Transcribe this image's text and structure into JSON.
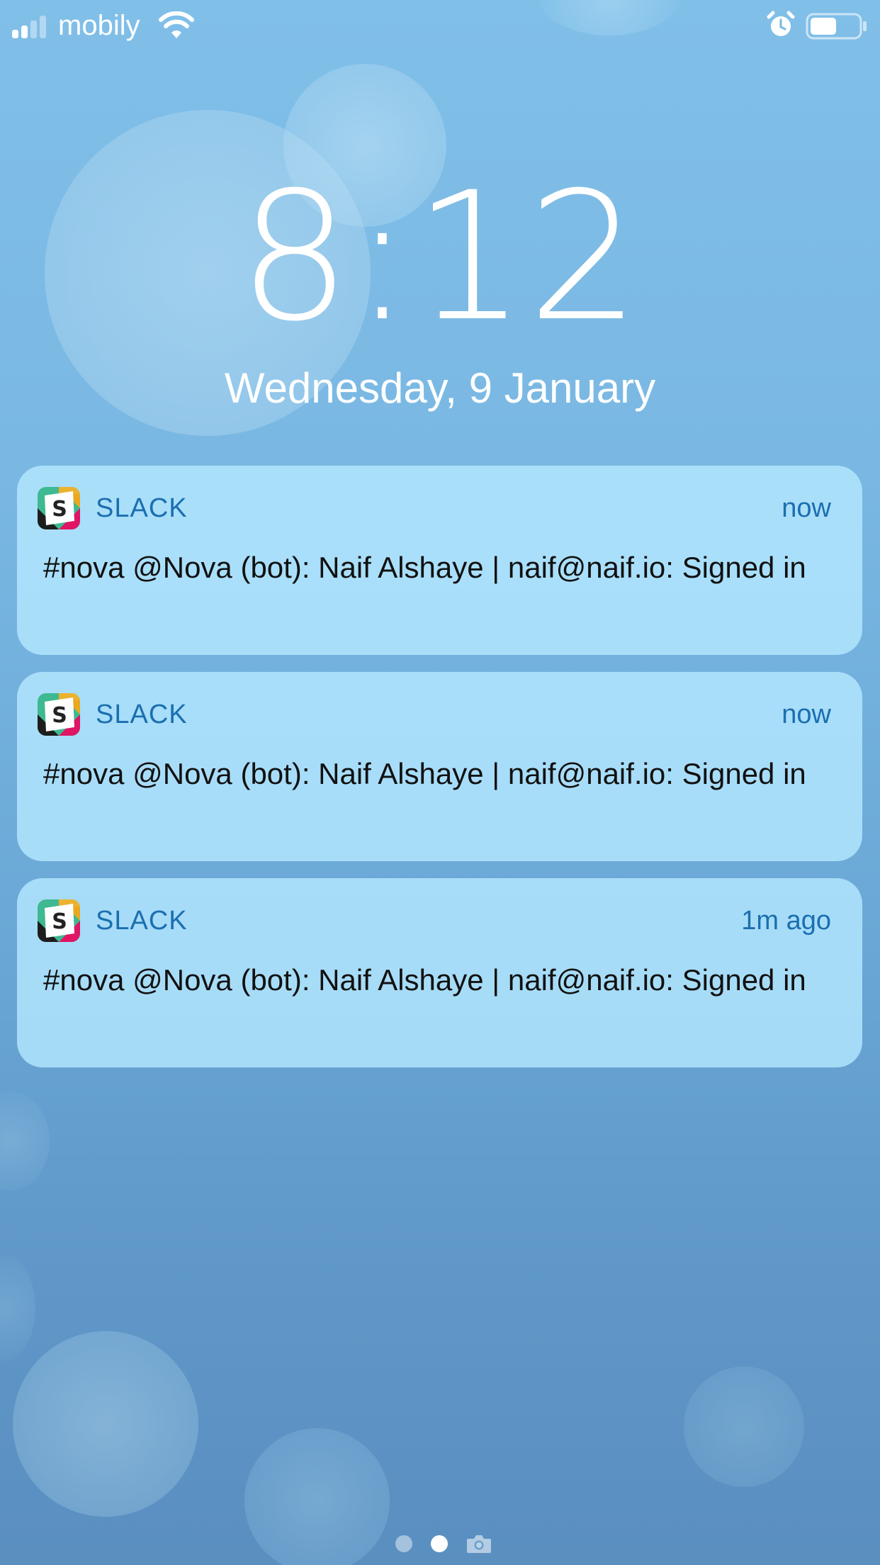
{
  "status_bar": {
    "carrier": "mobily",
    "signal_bars_filled": 2,
    "signal_bars_total": 4,
    "wifi_icon": "wifi-icon",
    "alarm_icon": "alarm-clock-icon",
    "battery_level": 0.55
  },
  "lock_screen": {
    "time": "8:12",
    "date": "Wednesday, 9 January"
  },
  "notifications": [
    {
      "app": "SLACK",
      "time": "now",
      "message": "#nova @Nova (bot): Naif Alshaye | naif@naif.io: Signed in",
      "icon": "slack-icon"
    },
    {
      "app": "SLACK",
      "time": "now",
      "message": "#nova @Nova (bot): Naif Alshaye | naif@naif.io: Signed in",
      "icon": "slack-icon"
    },
    {
      "app": "SLACK",
      "time": "1m ago",
      "message": "#nova @Nova (bot): Naif Alshaye | naif@naif.io: Signed in",
      "icon": "slack-icon"
    }
  ],
  "page_indicator": {
    "pages": 2,
    "current_page": 2,
    "camera_icon": "camera-icon"
  },
  "colors": {
    "accent_text": "#1b6fb0",
    "notification_bg": "#b4e8ff",
    "wallpaper_top": "#80bfe8",
    "wallpaper_bottom": "#5a8fc0"
  }
}
